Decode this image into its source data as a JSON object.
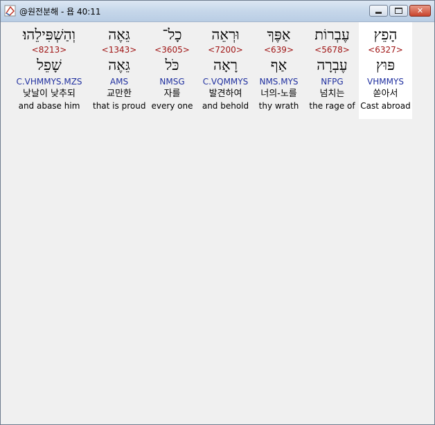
{
  "window": {
    "title": "@원전분해 - 욥 40:11",
    "minimize_label": "",
    "maximize_label": "",
    "close_label": "✕"
  },
  "words": [
    {
      "hebrew": "וְהַשְׁפִּילֵהוּ׃",
      "strong": "<8213>",
      "lemma": "שָׁפֵל",
      "parse": "C.VHMMYS.MZS",
      "korean": "낮날이 낮추되",
      "english": "and abase him"
    },
    {
      "hebrew": "גֵּאֶה",
      "strong": "<1343>",
      "lemma": "גֵּאֶה",
      "parse": "AMS",
      "korean": "교만한",
      "english": "that is proud"
    },
    {
      "hebrew": "כָל־",
      "strong": "<3605>",
      "lemma": "כֹּל",
      "parse": "NMSG",
      "korean": "자를",
      "english": "every one"
    },
    {
      "hebrew": "וּרְאֵה",
      "strong": "<7200>",
      "lemma": "רָאָה",
      "parse": "C.VQMMYS",
      "korean": "발견하여",
      "english": "and behold"
    },
    {
      "hebrew": "אַפֶּךָ",
      "strong": "<639>",
      "lemma": "אַף",
      "parse": "NMS.MYS",
      "korean": "너의-노를",
      "english": "thy wrath"
    },
    {
      "hebrew": "עֶבְרוֹת",
      "strong": "<5678>",
      "lemma": "עֶבְרָה",
      "parse": "NFPG",
      "korean": "넘치는",
      "english": "the rage of"
    },
    {
      "hebrew": "הָפֵץ",
      "strong": "<6327>",
      "lemma": "פּוּץ",
      "parse": "VHMMYS",
      "korean": "쏟아서",
      "english": "Cast abroad"
    }
  ]
}
